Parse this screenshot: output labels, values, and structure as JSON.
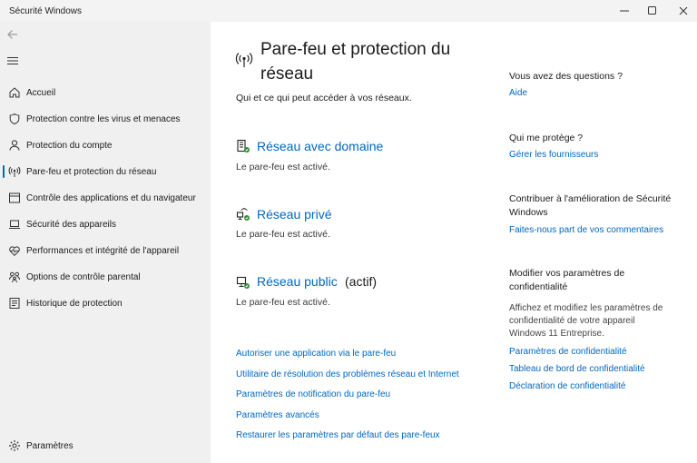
{
  "window": {
    "title": "Sécurité Windows",
    "controls": [
      "minimize-icon",
      "maximize-icon",
      "close-icon"
    ]
  },
  "sidebar": {
    "back_icon": "arrow-left-icon",
    "menu_icon": "hamburger-icon",
    "items": [
      {
        "label": "Accueil",
        "icon": "home-icon"
      },
      {
        "label": "Protection contre les virus et menaces",
        "icon": "shield-icon"
      },
      {
        "label": "Protection du compte",
        "icon": "person-icon"
      },
      {
        "label": "Pare-feu et protection du réseau",
        "icon": "antenna-icon",
        "selected": true
      },
      {
        "label": "Contrôle des applications et du navigateur",
        "icon": "browser-window-icon"
      },
      {
        "label": "Sécurité des appareils",
        "icon": "laptop-icon"
      },
      {
        "label": "Performances et intégrité de l'appareil",
        "icon": "heart-pulse-icon"
      },
      {
        "label": "Options de contrôle parental",
        "icon": "family-icon"
      },
      {
        "label": "Historique de protection",
        "icon": "history-icon"
      }
    ],
    "settings": {
      "label": "Paramètres",
      "icon": "gear-icon"
    }
  },
  "main": {
    "title": "Pare-feu et protection du réseau",
    "subtitle": "Qui et ce qui peut accéder à vos réseaux.",
    "networks": [
      {
        "name": "Réseau avec domaine",
        "suffix": "",
        "status": "Le pare-feu est activé.",
        "icon": "domain-network-icon"
      },
      {
        "name": "Réseau privé",
        "suffix": "",
        "status": "Le pare-feu est activé.",
        "icon": "private-network-icon"
      },
      {
        "name": "Réseau public",
        "suffix": "(actif)",
        "status": "Le pare-feu est activé.",
        "icon": "public-network-icon"
      }
    ],
    "links": [
      "Autoriser une application via le pare-feu",
      "Utilitaire de résolution des problèmes réseau et Internet",
      "Paramètres de notification du pare-feu",
      "Paramètres avancés",
      "Restaurer les paramètres par défaut des pare-feux"
    ]
  },
  "right_panel": {
    "questions": {
      "heading": "Vous avez des questions ?",
      "link": "Aide"
    },
    "protection": {
      "heading": "Qui me protège ?",
      "link": "Gérer les fournisseurs"
    },
    "improve": {
      "heading": "Contribuer à l'amélioration de Sécurité Windows",
      "link": "Faites-nous part de vos commentaires"
    },
    "privacy": {
      "heading": "Modifier vos paramètres de confidentialité",
      "text": "Affichez et modifiez les paramètres de confidentialité de votre appareil Windows 11 Entreprise.",
      "links": [
        "Paramètres de confidentialité",
        "Tableau de bord de confidentialité",
        "Déclaration de confidentialité"
      ]
    }
  },
  "colors": {
    "accent": "#0067c0",
    "sidebar_bg": "#f0f0f0",
    "status_green": "#2f8a3a"
  }
}
